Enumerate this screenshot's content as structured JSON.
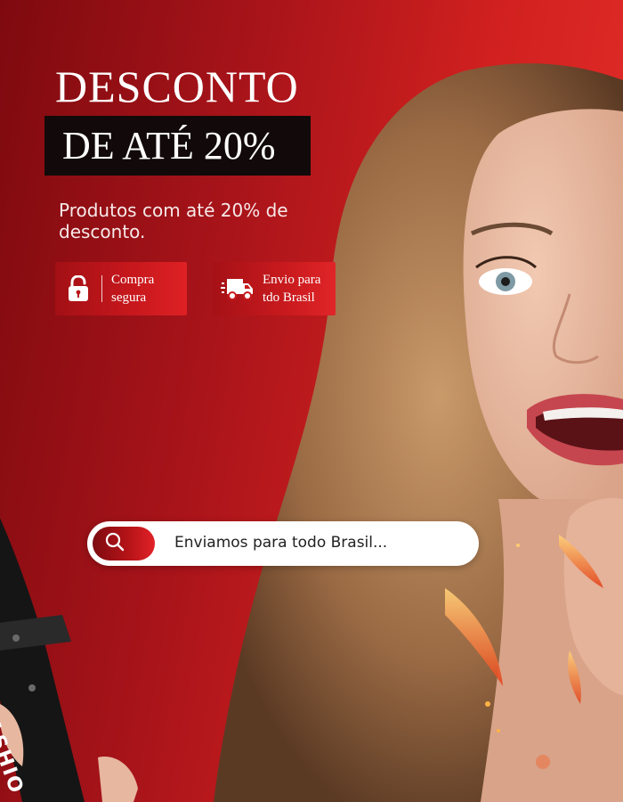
{
  "headline": {
    "line1": "DESCONTO",
    "line2": "DE ATÉ 20%"
  },
  "subtitle": "Produtos com até 20% de desconto.",
  "badges": [
    {
      "label": "Compra\nsegura",
      "icon": "unlock-icon"
    },
    {
      "label": "Envio para\ntdo Brasil",
      "icon": "delivery-truck-icon"
    }
  ],
  "search": {
    "text": "Enviamos para todo Brasil...",
    "icon": "search-icon"
  },
  "product_brand_text": "FASHIO",
  "colors": {
    "background_dark": "#7e0a0f",
    "background_light": "#e8312c",
    "headline_box": "#120a0a",
    "text": "#ffffff"
  }
}
